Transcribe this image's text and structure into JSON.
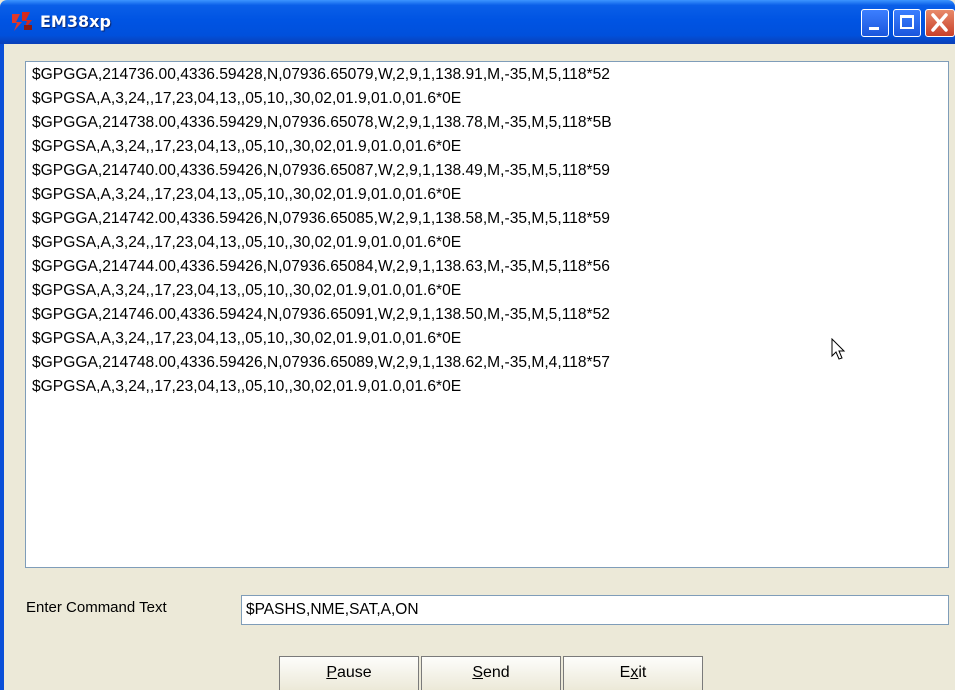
{
  "window": {
    "title": "EM38xp"
  },
  "log": {
    "lines": [
      "$GPGGA,214736.00,4336.59428,N,07936.65079,W,2,9,1,138.91,M,-35,M,5,118*52",
      "$GPGSA,A,3,24,,17,23,04,13,,05,10,,30,02,01.9,01.0,01.6*0E",
      "$GPGGA,214738.00,4336.59429,N,07936.65078,W,2,9,1,138.78,M,-35,M,5,118*5B",
      "$GPGSA,A,3,24,,17,23,04,13,,05,10,,30,02,01.9,01.0,01.6*0E",
      "$GPGGA,214740.00,4336.59426,N,07936.65087,W,2,9,1,138.49,M,-35,M,5,118*59",
      "$GPGSA,A,3,24,,17,23,04,13,,05,10,,30,02,01.9,01.0,01.6*0E",
      "$GPGGA,214742.00,4336.59426,N,07936.65085,W,2,9,1,138.58,M,-35,M,5,118*59",
      "$GPGSA,A,3,24,,17,23,04,13,,05,10,,30,02,01.9,01.0,01.6*0E",
      "$GPGGA,214744.00,4336.59426,N,07936.65084,W,2,9,1,138.63,M,-35,M,5,118*56",
      "$GPGSA,A,3,24,,17,23,04,13,,05,10,,30,02,01.9,01.0,01.6*0E",
      "$GPGGA,214746.00,4336.59424,N,07936.65091,W,2,9,1,138.50,M,-35,M,5,118*52",
      "$GPGSA,A,3,24,,17,23,04,13,,05,10,,30,02,01.9,01.0,01.6*0E",
      "$GPGGA,214748.00,4336.59426,N,07936.65089,W,2,9,1,138.62,M,-35,M,4,118*57",
      "$GPGSA,A,3,24,,17,23,04,13,,05,10,,30,02,01.9,01.0,01.6*0E"
    ]
  },
  "command": {
    "label": "Enter Command Text",
    "value": "$PASHS,NME,SAT,A,ON"
  },
  "buttons": {
    "pause": {
      "mnemonic": "P",
      "rest": "ause"
    },
    "send": {
      "mnemonic": "S",
      "rest": "end"
    },
    "exit": {
      "pre": "E",
      "mnemonic": "x",
      "rest": "it"
    }
  },
  "icons": {
    "app": "em38-app-icon",
    "cursor": "mouse-pointer-icon"
  },
  "colors": {
    "titlebar": "#0054e3",
    "close": "#c8402a",
    "background": "#ece9d8"
  }
}
